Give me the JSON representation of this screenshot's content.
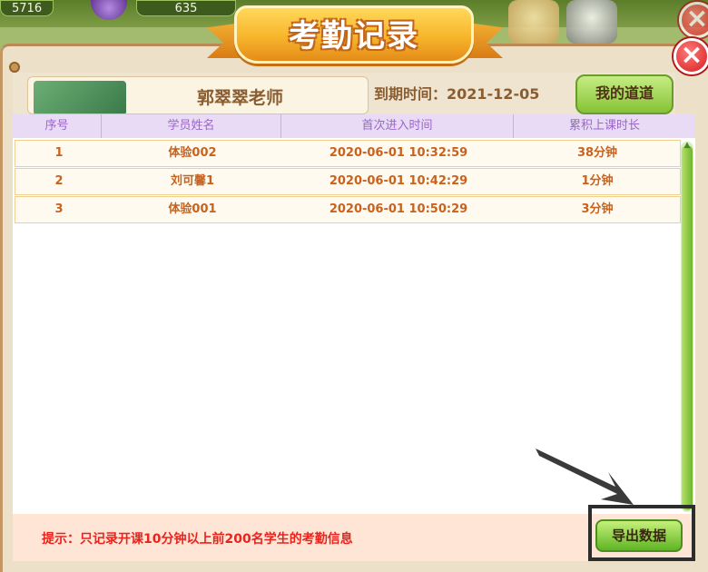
{
  "background": {
    "resource_1": "5716",
    "resource_2": "635"
  },
  "dialog": {
    "title": "考勤记录",
    "teacher_name": "郭翠翠老师",
    "due_date": "到期时间：2021-12-05",
    "my_button": "我的道道",
    "close_symbol": "×"
  },
  "table": {
    "headers": [
      "序号",
      "学员姓名",
      "首次进入时间",
      "累积上课时长"
    ],
    "rows": [
      {
        "index": "1",
        "name": "体验002",
        "first_entry": "2020-06-01 10:32:59",
        "duration": "38分钟"
      },
      {
        "index": "2",
        "name": "刘可馨1",
        "first_entry": "2020-06-01 10:42:29",
        "duration": "1分钟"
      },
      {
        "index": "3",
        "name": "体验001",
        "first_entry": "2020-06-01 10:50:29",
        "duration": "3分钟"
      }
    ]
  },
  "footer": {
    "tip": "提示：只记录开课10分钟以上前200名学生的考勤信息",
    "export_label": "导出数据"
  },
  "colors": {
    "accent_green": "#6fb42d",
    "title_orange": "#f7b52c",
    "text_orange": "#c8621d",
    "header_purple": "#9a66c8",
    "tip_red": "#e8241d"
  }
}
